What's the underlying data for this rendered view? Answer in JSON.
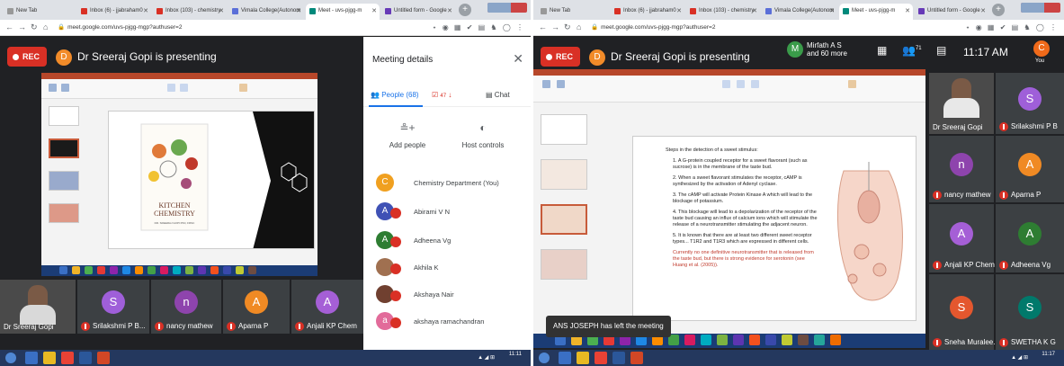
{
  "left": {
    "tabs": [
      {
        "title": "New Tab",
        "color": "#999999",
        "active": false
      },
      {
        "title": "Inbox (6) - jjabraham0",
        "color": "#d93025",
        "active": false
      },
      {
        "title": "Inbox (103) - chemistry",
        "color": "#d93025",
        "active": false
      },
      {
        "title": "Vimala College(Autonom",
        "color": "#5b6fd8",
        "active": false
      },
      {
        "title": "Meet - uvs-pjgg-m",
        "color": "#00897b",
        "active": true
      },
      {
        "title": "Untitled form - Google",
        "color": "#673ab7",
        "active": false
      }
    ],
    "url": "meet.google.com/uvs-pjgg-mgp?authuser=2",
    "rec_label": "REC",
    "presenter_avatar": "D",
    "presenter_text": "Dr Sreeraj Gopi is presenting",
    "slide": {
      "title_line1": "KITCHEN",
      "title_line2": "CHEMISTRY",
      "author": "DR. SREERAJ GOPI PhD, FRSC"
    },
    "tiles": [
      {
        "name": "Dr Sreeraj Gopi",
        "initial": "",
        "color": "#3c4043",
        "video": true,
        "muted": false
      },
      {
        "name": "Srilakshmi P B...",
        "initial": "S",
        "color": "#9f5fd9",
        "video": false,
        "muted": true
      },
      {
        "name": "nancy mathew",
        "initial": "n",
        "color": "#8e44ad",
        "video": false,
        "muted": true
      },
      {
        "name": "Aparna P",
        "initial": "A",
        "color": "#f08a24",
        "video": false,
        "muted": true
      },
      {
        "name": "Anjali KP Chem",
        "initial": "A",
        "color": "#a55fd6",
        "video": false,
        "muted": true
      }
    ],
    "panel": {
      "title": "Meeting details",
      "people_label": "People (68)",
      "chat_count": "47",
      "chat_label": "Chat",
      "add_people": "Add people",
      "host_controls": "Host controls",
      "people": [
        {
          "name": "Chemistry Department (You)",
          "initial": "C",
          "color": "#f0a020",
          "muted": false
        },
        {
          "name": "Abirami V N",
          "initial": "A",
          "color": "#3f51b5",
          "muted": true
        },
        {
          "name": "Adheena Vg",
          "initial": "A",
          "color": "#2e7d32",
          "muted": true
        },
        {
          "name": "Akhila K",
          "initial": "",
          "color": "#a07050",
          "muted": true
        },
        {
          "name": "Akshaya Nair",
          "initial": "",
          "color": "#704030",
          "muted": true
        },
        {
          "name": "akshaya ramachandran",
          "initial": "a",
          "color": "#e26b9a",
          "muted": true
        }
      ]
    },
    "taskbar_time": "11:11"
  },
  "right": {
    "tabs": [
      {
        "title": "New Tab",
        "color": "#999999",
        "active": false
      },
      {
        "title": "Inbox (6) - jjabraham0",
        "color": "#d93025",
        "active": false
      },
      {
        "title": "Inbox (103) - chemistry",
        "color": "#d93025",
        "active": false
      },
      {
        "title": "Vimala College(Autonom",
        "color": "#5b6fd8",
        "active": false
      },
      {
        "title": "Meet - uvs-pjgg-m",
        "color": "#00897b",
        "active": true
      },
      {
        "title": "Untitled form - Google",
        "color": "#673ab7",
        "active": false
      }
    ],
    "url": "meet.google.com/uvs-pjgg-mgp?authuser=2",
    "rec_label": "REC",
    "presenter_avatar": "D",
    "presenter_text": "Dr Sreeraj Gopi is presenting",
    "participant_avatar": "M",
    "participant_line1": "Mirfath A S",
    "participant_line2": "and 60 more",
    "people_count": "71",
    "clock": "11:17 AM",
    "you_label": "You",
    "you_avatar": "C",
    "slide_heading": "Steps in the detection of a sweet stimulus:",
    "slide_points": [
      "A G-protein coupled receptor for a sweet flavorant (such as sucrose) is in the membrane of the taste bud.",
      "When a sweet flavorant stimulates the receptor, cAMP is synthesized by the activation of Adenyl cyclase.",
      "The cAMP will activate Protein Kinase A which will lead to the blockage of potassium.",
      "This blockage will lead to a depolarization of the receptor of the taste bud causing an influx of calcium ions which will stimulate the release of a neurotransmitter stimulating the adjacent neuron.",
      "It is known that there are at least two different sweet receptor types... T1R2 and T1R3 which are expressed in different cells."
    ],
    "slide_note": "Currently no one definitive neurotransmitter that is released from the taste bud, but there is strong evidence for serotonin (see Huang et al. (2005)).",
    "notification": "ANS JOSEPH has left the meeting",
    "tiles": [
      {
        "name": "Dr Sreeraj Gopi",
        "initial": "",
        "color": "#3c4043",
        "video": true,
        "muted": false
      },
      {
        "name": "Srilakshmi P B",
        "initial": "S",
        "color": "#9f5fd9",
        "video": false,
        "muted": true
      },
      {
        "name": "nancy mathew",
        "initial": "n",
        "color": "#8e44ad",
        "video": false,
        "muted": true
      },
      {
        "name": "Aparna P",
        "initial": "A",
        "color": "#f08a24",
        "video": false,
        "muted": true
      },
      {
        "name": "Anjali KP Chem",
        "initial": "A",
        "color": "#a55fd6",
        "video": false,
        "muted": true
      },
      {
        "name": "Adheena Vg",
        "initial": "A",
        "color": "#2e7d32",
        "video": false,
        "muted": true
      },
      {
        "name": "Sneha Muralee...",
        "initial": "S",
        "color": "#e4572e",
        "video": false,
        "muted": true
      },
      {
        "name": "SWETHA K G",
        "initial": "S",
        "color": "#00796b",
        "video": false,
        "muted": true
      }
    ],
    "taskbar_time": "11:17"
  }
}
